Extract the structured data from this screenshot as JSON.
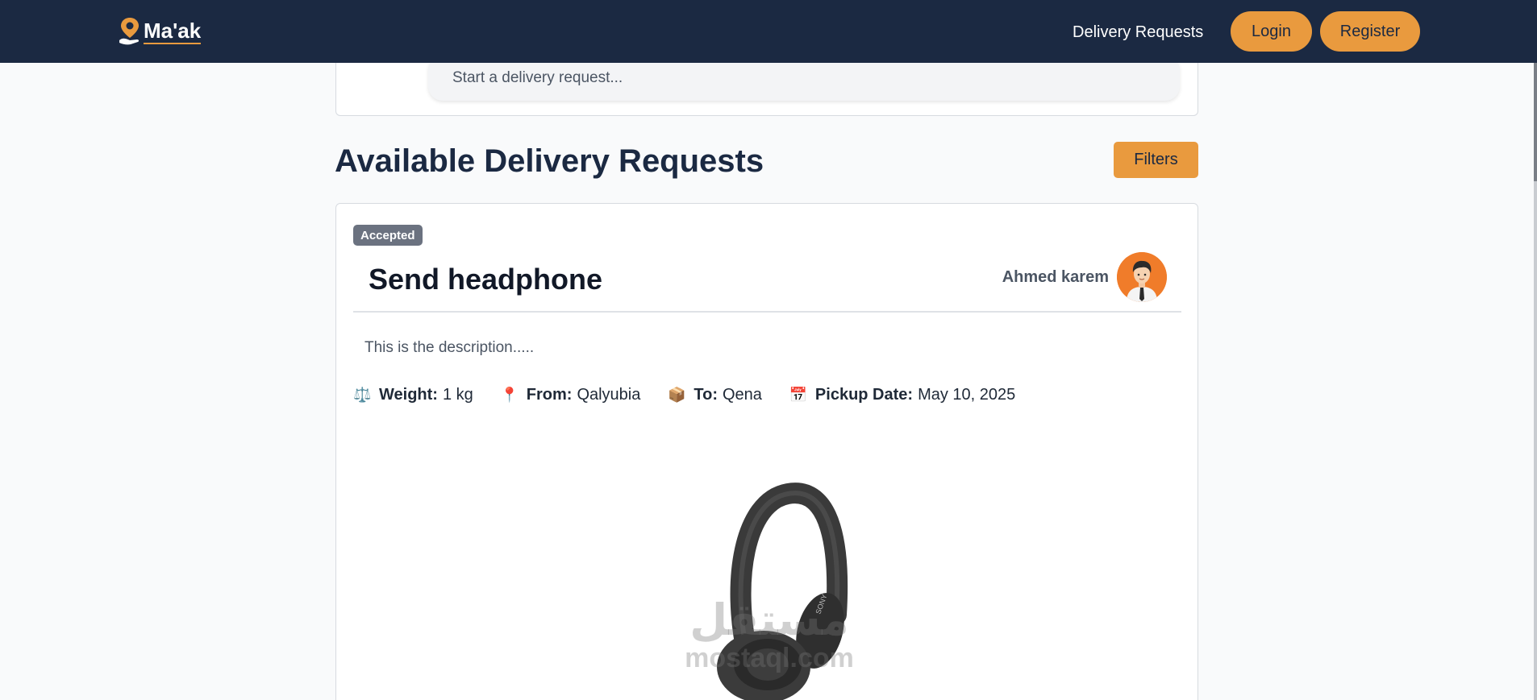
{
  "navbar": {
    "brand": "Ma'ak",
    "links": [
      {
        "label": "Delivery Requests"
      }
    ],
    "login_label": "Login",
    "register_label": "Register"
  },
  "composer": {
    "placeholder": "Start a delivery request..."
  },
  "section": {
    "title": "Available Delivery Requests",
    "filters_label": "Filters"
  },
  "request": {
    "status": "Accepted",
    "title": "Send headphone",
    "owner_name": "Ahmed karem",
    "description": "This is the description.....",
    "meta": [
      {
        "icon": "scale-icon",
        "glyph": "⚖️",
        "label": "Weight:",
        "value": "1 kg"
      },
      {
        "icon": "pin-icon",
        "glyph": "📍",
        "label": "From:",
        "value": "Qalyubia"
      },
      {
        "icon": "package-icon",
        "glyph": "📦",
        "label": "To:",
        "value": "Qena"
      },
      {
        "icon": "calendar-icon",
        "glyph": "📅",
        "label": "Pickup Date:",
        "value": "May 10, 2025"
      }
    ],
    "image_alt": "headphone",
    "watermark_ar": "مستقل",
    "watermark_en": "mostaql.com"
  },
  "colors": {
    "navbar_bg": "#1b2942",
    "accent": "#e99a3e",
    "badge_bg": "#6b7280",
    "avatar_bg": "#f07c2a"
  }
}
